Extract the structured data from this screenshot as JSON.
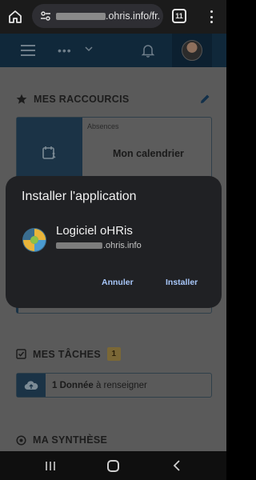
{
  "browser": {
    "url_text": ".ohris.info/fr.",
    "tab_count": "11"
  },
  "page": {
    "shortcuts_title": "MES RACCOURCIS",
    "shortcut_category": "Absences",
    "shortcut_label": "Mon calendrier",
    "tasks_title": "MES TÂCHES",
    "tasks_count": "1",
    "task_bold": "1 Donnée",
    "task_rest": " à renseigner",
    "summary_title": "MA SYNTHÈSE"
  },
  "dialog": {
    "title": "Installer l'application",
    "app_name": "Logiciel oHRis",
    "domain_suffix": ".ohris.info",
    "cancel_label": "Annuler",
    "install_label": "Installer"
  }
}
